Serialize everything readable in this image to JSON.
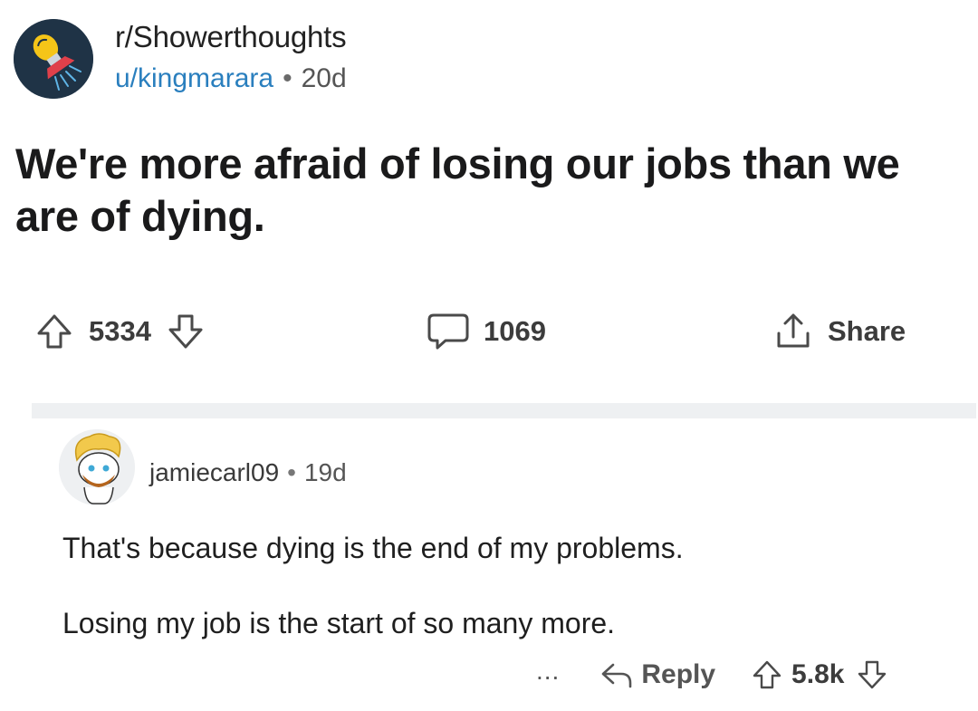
{
  "post": {
    "subreddit": "r/Showerthoughts",
    "author": "u/kingmarara",
    "separator": "•",
    "age": "20d",
    "title": "We're more afraid of losing our jobs than we are of dying.",
    "score": "5334",
    "comments": "1069",
    "share_label": "Share"
  },
  "comment": {
    "author": "jamiecarl09",
    "separator": "•",
    "age": "19d",
    "paragraphs": [
      "That's because dying is the end of my problems.",
      "Losing my job is the start of so many more."
    ],
    "more": "...",
    "reply_label": "Reply",
    "score": "5.8k"
  },
  "colors": {
    "background": "#ffffff",
    "author_link": "#2a7fbe",
    "subreddit_avatar_bg": "#1f3346",
    "divider": "#eef0f2"
  },
  "icons": {
    "upvote": "arrow-up-outline-icon",
    "downvote": "arrow-down-outline-icon",
    "comment": "speech-bubble-icon",
    "share": "upload-share-icon",
    "reply": "reply-arrow-icon",
    "subreddit_avatar": "lightbulb-shower-icon",
    "user_avatar": "snoo-avatar-icon"
  }
}
